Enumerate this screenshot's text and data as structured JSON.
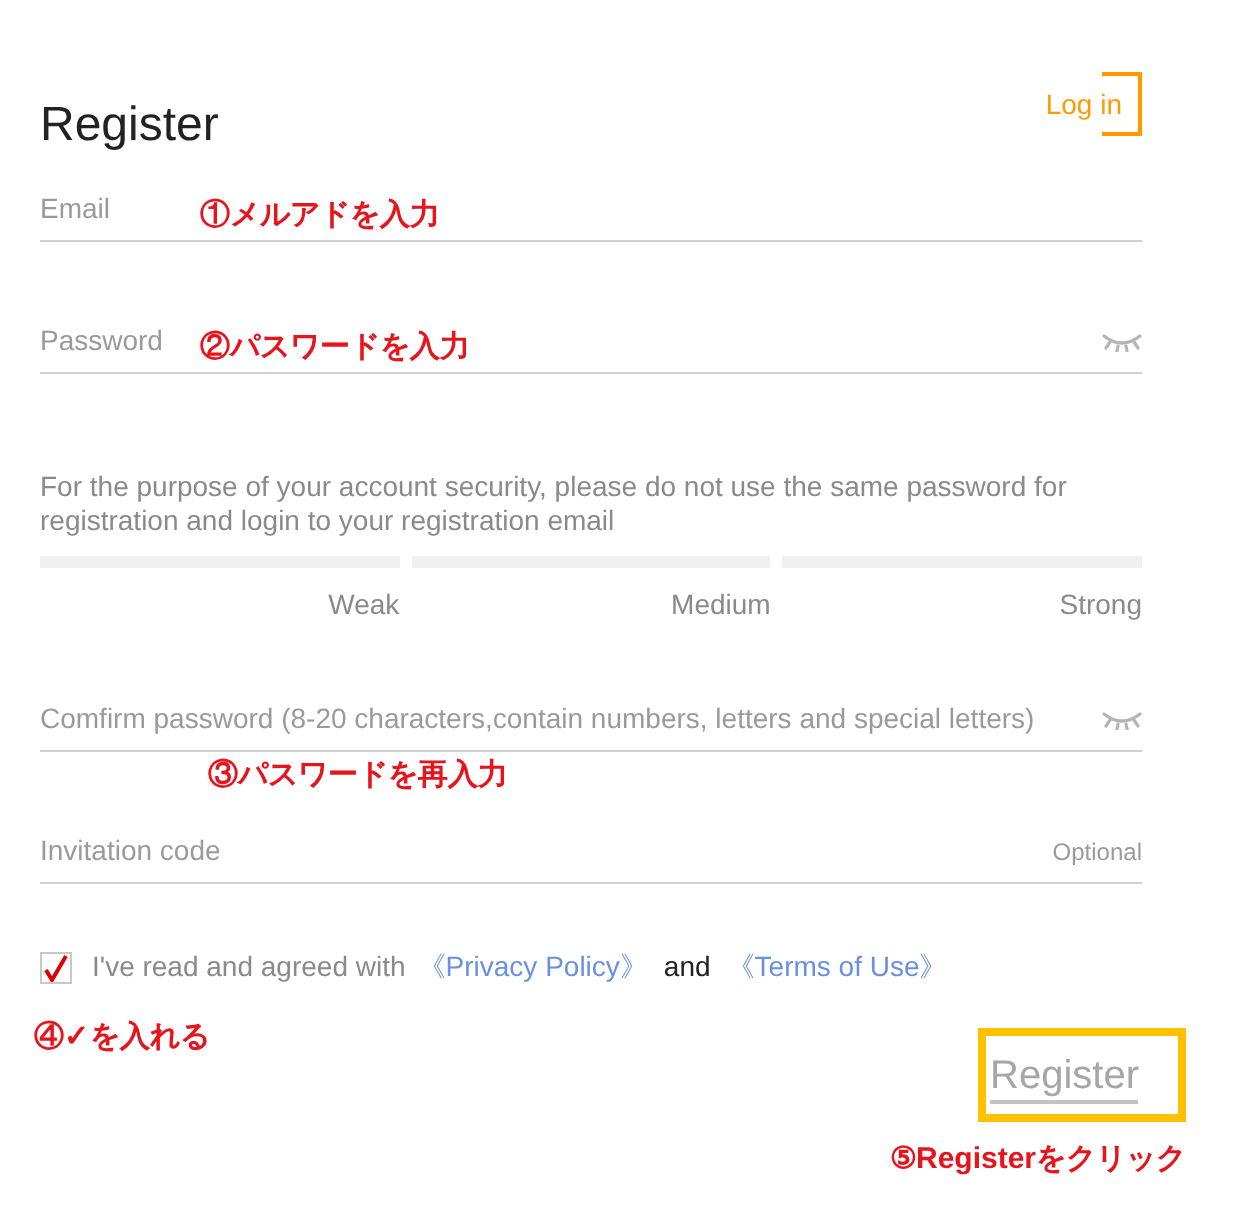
{
  "header": {
    "title": "Register",
    "login_link": "Log in"
  },
  "email": {
    "placeholder": "Email"
  },
  "password": {
    "placeholder": "Password"
  },
  "password_hint": "For the purpose of your account security, please do not use the same password for registration and login to your registration email",
  "strength": {
    "labels": [
      "Weak",
      "Medium",
      "Strong"
    ]
  },
  "confirm_password": {
    "placeholder": "Comfirm password (8-20 characters,contain numbers, letters and special letters)"
  },
  "invitation": {
    "placeholder": "Invitation code",
    "tag": "Optional"
  },
  "agreement": {
    "checked": true,
    "text": "I've read and agreed with",
    "privacy_link": "《Privacy Policy》",
    "joiner": "and",
    "terms_link": "《Terms of Use》"
  },
  "register_button": "Register",
  "annotations": [
    {
      "text": "①メルアドを入力"
    },
    {
      "text": "②パスワードを入力"
    },
    {
      "text": "③パスワードを再入力"
    },
    {
      "text": "④✓を入れる"
    },
    {
      "text": "⑤Registerをクリック"
    }
  ]
}
